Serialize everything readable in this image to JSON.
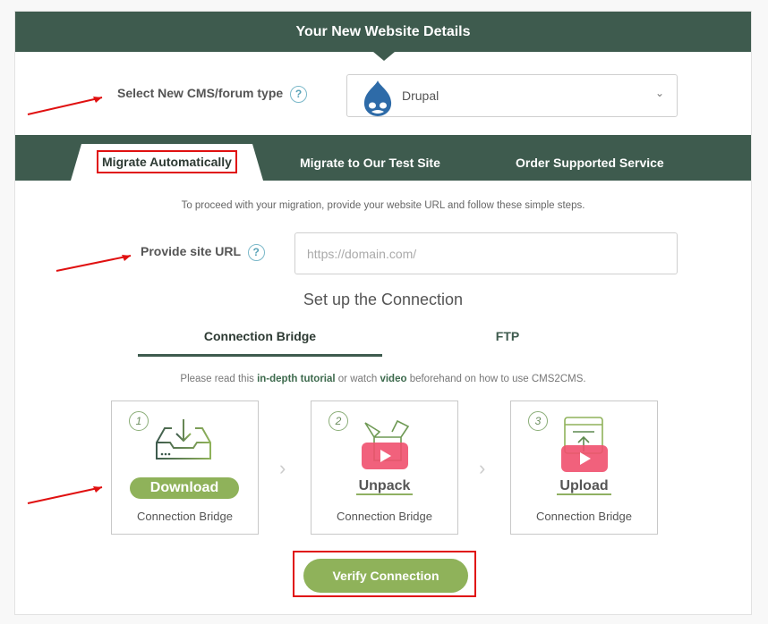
{
  "header": {
    "title": "Your New Website Details"
  },
  "cms": {
    "label": "Select New CMS/forum type",
    "help": "?",
    "selected": "Drupal",
    "icon": "drupal-logo"
  },
  "tabs": [
    {
      "label": "Migrate Automatically",
      "active": true
    },
    {
      "label": "Migrate to Our Test Site",
      "active": false
    },
    {
      "label": "Order Supported Service",
      "active": false
    }
  ],
  "description": "To proceed with your migration, provide your website URL and follow these simple steps.",
  "url": {
    "label": "Provide site URL",
    "help": "?",
    "placeholder": "https://domain.com/",
    "value": ""
  },
  "connection": {
    "title": "Set up the Connection",
    "tabs": [
      {
        "label": "Connection Bridge",
        "active": true
      },
      {
        "label": "FTP",
        "active": false
      }
    ],
    "tutorial": {
      "prefix": "Please read this ",
      "tutorial_link": "in-depth tutorial",
      "middle": " or watch ",
      "video_link": "video",
      "suffix": " beforehand on how to use CMS2CMS."
    }
  },
  "steps": [
    {
      "number": "1",
      "action": "Download",
      "subtitle": "Connection Bridge",
      "icon": "download-tray-icon"
    },
    {
      "number": "2",
      "action": "Unpack",
      "subtitle": "Connection Bridge",
      "icon": "open-box-icon"
    },
    {
      "number": "3",
      "action": "Upload",
      "subtitle": "Connection Bridge",
      "icon": "upload-window-icon"
    }
  ],
  "step_separator": "›",
  "verify_button": "Verify Connection",
  "colors": {
    "header_bg": "#3e5b4e",
    "accent_green": "#8fb25a",
    "annotation_red": "#e01010",
    "video_red": "#f0506e"
  }
}
